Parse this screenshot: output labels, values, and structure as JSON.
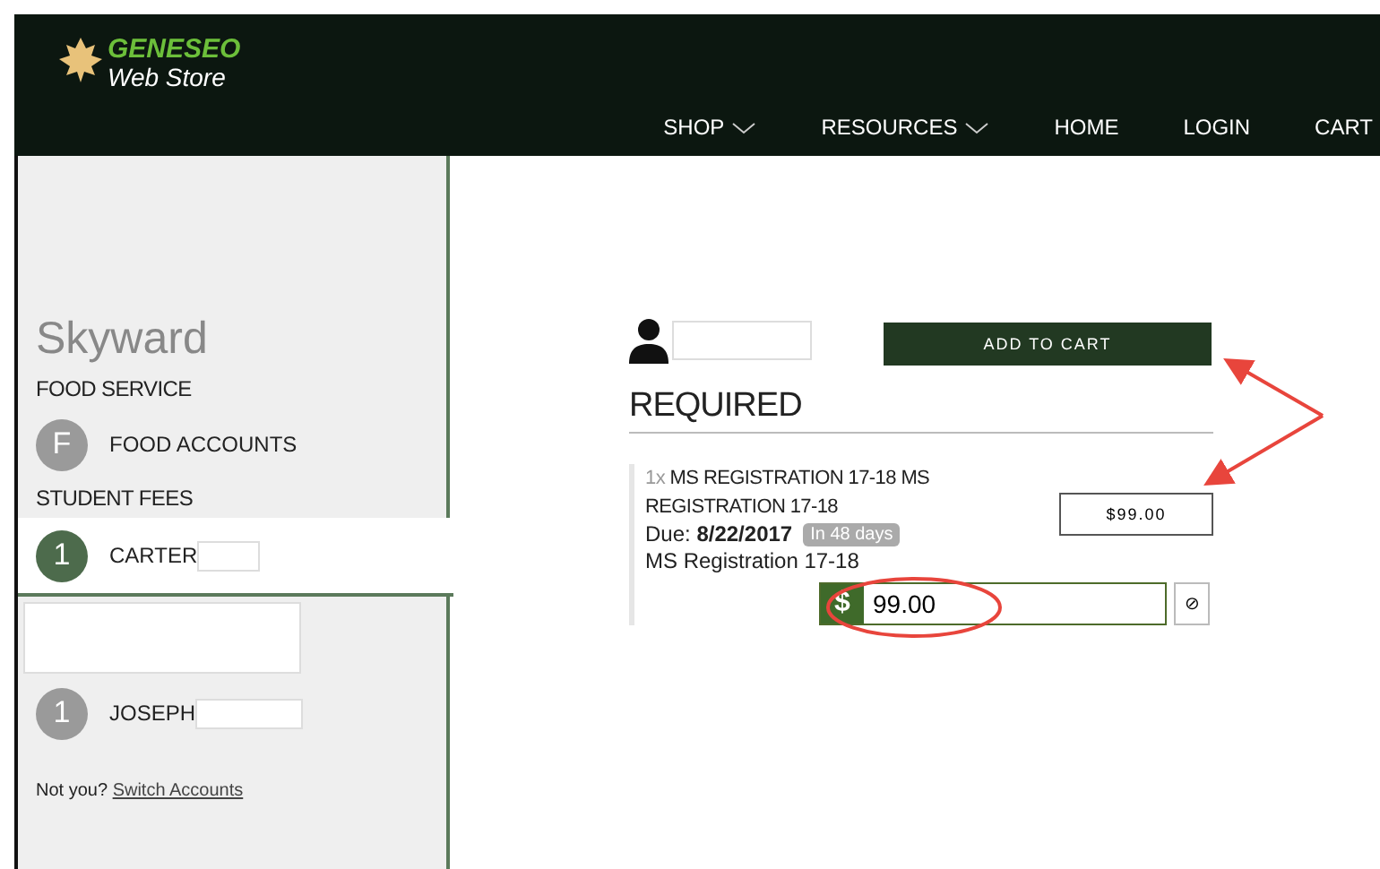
{
  "header": {
    "logo": {
      "title": "GENESEO",
      "subtitle": "Web Store"
    },
    "nav": [
      {
        "label": "SHOP",
        "dropdown": true
      },
      {
        "label": "RESOURCES",
        "dropdown": true
      },
      {
        "label": "HOME",
        "dropdown": false
      },
      {
        "label": "LOGIN",
        "dropdown": false
      },
      {
        "label": "CART",
        "dropdown": false
      }
    ]
  },
  "sidebar": {
    "title": "Skyward",
    "sections": [
      {
        "heading": "FOOD SERVICE",
        "items": [
          {
            "badge": "F",
            "label": "FOOD ACCOUNTS",
            "selected": false
          }
        ]
      },
      {
        "heading": "STUDENT FEES",
        "items": [
          {
            "badge": "1",
            "label": "CARTER",
            "selected": true
          },
          {
            "badge": "1",
            "label": "JOSEPH",
            "selected": false
          }
        ]
      }
    ],
    "footer": {
      "prefix": "Not you?",
      "link": "Switch Accounts"
    }
  },
  "main": {
    "button": "ADD TO CART",
    "heading": "REQUIRED",
    "item": {
      "qty": "1x",
      "name": "MS REGISTRATION 17-18 MS REGISTRATION 17-18",
      "due_label": "Due:",
      "due_date": "8/22/2017",
      "due_badge": "In 48 days",
      "description": "MS Registration 17-18",
      "price": "$99.00",
      "currency": "$",
      "amount": "99.00",
      "clear": "⊘"
    }
  }
}
